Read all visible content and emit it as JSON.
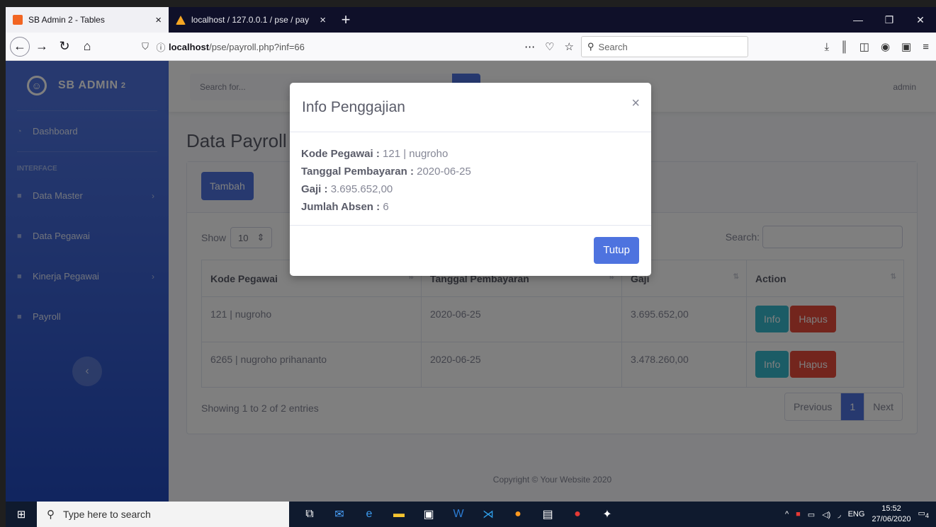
{
  "browser": {
    "tabs": [
      {
        "title": "SB Admin 2 - Tables",
        "close": "×"
      },
      {
        "title": "localhost / 127.0.0.1 / pse / pay",
        "close": "×"
      }
    ],
    "new_tab": "+",
    "url_host": "localhost",
    "url_path": "/pse/payroll.php?inf=66",
    "search_placeholder": "Search"
  },
  "sidebar": {
    "brand": "SB ADMIN",
    "brand_sup": "2",
    "heading_interface": "INTERFACE",
    "items": [
      {
        "label": "Dashboard"
      },
      {
        "label": "Data Master"
      },
      {
        "label": "Data Pegawai"
      },
      {
        "label": "Kinerja Pegawai"
      },
      {
        "label": "Payroll"
      }
    ]
  },
  "topbar": {
    "search_placeholder": "Search for...",
    "user": "admin"
  },
  "content": {
    "page_title": "Data Payroll",
    "add_button": "Tambah",
    "show_label": "Show",
    "show_value": "10",
    "search_label": "Search:",
    "columns": [
      "Kode Pegawai",
      "Tanggal Pembayaran",
      "Gaji",
      "Action"
    ],
    "rows": [
      {
        "kode": "121 | nugroho",
        "tanggal": "2020-06-25",
        "gaji": "3.695.652,00",
        "info": "Info",
        "hapus": "Hapus"
      },
      {
        "kode": "6265 | nugroho prihananto",
        "tanggal": "2020-06-25",
        "gaji": "3.478.260,00",
        "info": "Info",
        "hapus": "Hapus"
      }
    ],
    "showing": "Showing 1 to 2 of 2 entries",
    "pager": {
      "previous": "Previous",
      "page": "1",
      "next": "Next"
    },
    "footer": "Copyright © Your Website 2020"
  },
  "modal": {
    "title": "Info Penggajian",
    "close": "×",
    "fields": [
      {
        "label": "Kode Pegawai :",
        "value": "121 | nugroho"
      },
      {
        "label": "Tanggal Pembayaran :",
        "value": "2020-06-25"
      },
      {
        "label": "Gaji :",
        "value": "3.695.652,00"
      },
      {
        "label": "Jumlah Absen :",
        "value": "6"
      }
    ],
    "button": "Tutup"
  },
  "taskbar": {
    "search_placeholder": "Type here to search",
    "lang": "ENG",
    "time": "15:52",
    "date": "27/06/2020",
    "notifications": "4"
  }
}
